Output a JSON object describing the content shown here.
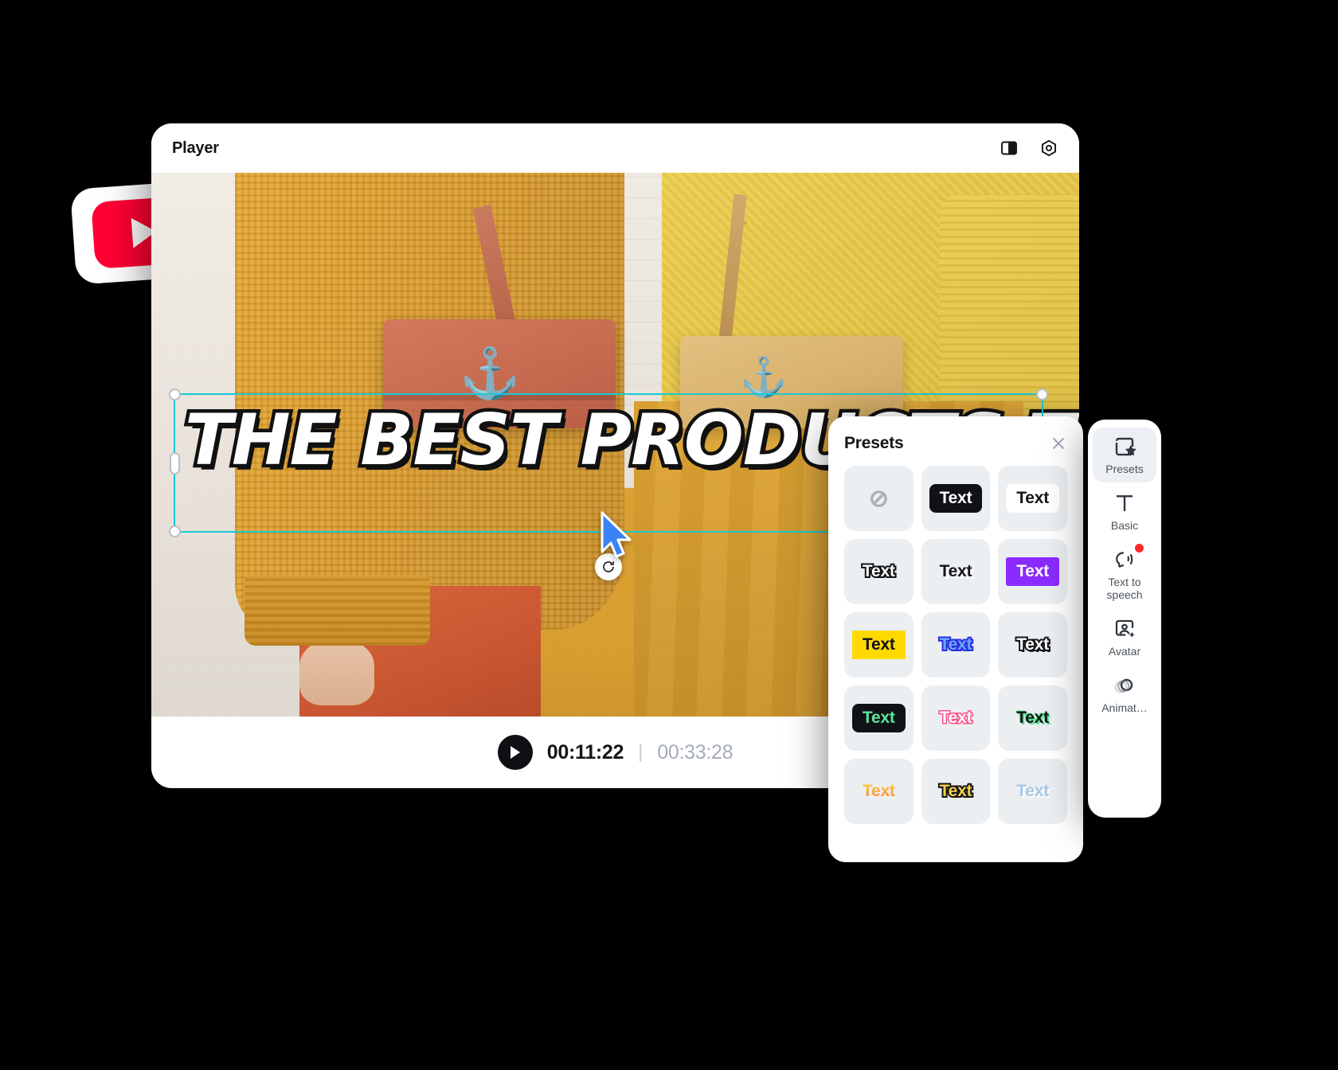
{
  "player": {
    "title": "Player",
    "header_icons": [
      {
        "name": "split-view-icon",
        "label": "split-view"
      },
      {
        "name": "settings-icon",
        "label": "settings"
      }
    ],
    "canvas": {
      "headline_text": "THE BEST PRODUCTS TO SELL",
      "selection": {
        "accent_color": "#19c9d4",
        "handles": [
          "top-left",
          "top-right",
          "bottom-left",
          "bottom-right",
          "middle-left",
          "middle-right"
        ],
        "rotate_handle": "rotate"
      },
      "cursor": "arrow-cursor"
    },
    "controls": {
      "play_label": "play",
      "current_time": "00:11:22",
      "separator": "|",
      "total_time": "00:33:28"
    }
  },
  "youtube_badge": {
    "name": "youtube-logo",
    "color": "#ff0033"
  },
  "presets_panel": {
    "title": "Presets",
    "close_label": "close",
    "items": [
      {
        "label": "Text",
        "style": "none",
        "display": "⊘"
      },
      {
        "label": "Text",
        "style": "black-chip"
      },
      {
        "label": "Text",
        "style": "white-chip"
      },
      {
        "label": "Text",
        "style": "outline-dark"
      },
      {
        "label": "Text",
        "style": "shadow-plain"
      },
      {
        "label": "Text",
        "style": "purple-chip"
      },
      {
        "label": "Text",
        "style": "yellow-chip"
      },
      {
        "label": "Text",
        "style": "blue-outline"
      },
      {
        "label": "Text",
        "style": "white-outline-dark"
      },
      {
        "label": "Text",
        "style": "green-on-black"
      },
      {
        "label": "Text",
        "style": "pink-outline"
      },
      {
        "label": "Text",
        "style": "green-glow"
      },
      {
        "label": "Text",
        "style": "orange-grad"
      },
      {
        "label": "Text",
        "style": "gold-outline"
      },
      {
        "label": "Text",
        "style": "lightblue"
      }
    ]
  },
  "right_toolbar": {
    "items": [
      {
        "label": "Presets",
        "icon": "presets-star-icon",
        "active": true,
        "badge": false
      },
      {
        "label": "Basic",
        "icon": "text-t-icon",
        "active": false,
        "badge": false
      },
      {
        "label": "Text to speech",
        "icon": "text-to-speech-icon",
        "active": false,
        "badge": true
      },
      {
        "label": "Avatar",
        "icon": "avatar-icon",
        "active": false,
        "badge": false
      },
      {
        "label": "Animat…",
        "icon": "animation-icon",
        "active": false,
        "badge": false
      }
    ]
  }
}
